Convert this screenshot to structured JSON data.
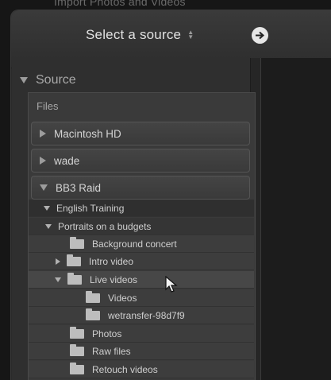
{
  "background_title": "Import Photos and Videos",
  "header": {
    "title": "Select a source",
    "updown_icon": "updown-arrows-icon",
    "next_icon": "arrow-right-circle-icon"
  },
  "source_panel": {
    "title": "Source",
    "files_label": "Files",
    "volumes": [
      {
        "label": "Macintosh HD",
        "expanded": false
      },
      {
        "label": "wade",
        "expanded": false
      },
      {
        "label": "BB3 Raid",
        "expanded": true
      }
    ],
    "folders": [
      {
        "label": "English Training",
        "level": 1,
        "expanded": true
      },
      {
        "label": "Portraits on a budgets",
        "level": 1,
        "expanded": true
      },
      {
        "label": "Background concert",
        "level": 2
      },
      {
        "label": "Intro video",
        "level": 2,
        "expanded": false
      },
      {
        "label": "Live videos",
        "level": 2,
        "expanded": true
      },
      {
        "label": "Videos",
        "level": 3
      },
      {
        "label": "wetransfer-98d7f9",
        "level": 3
      },
      {
        "label": "Photos",
        "level": 2
      },
      {
        "label": "Raw files",
        "level": 2
      },
      {
        "label": "Retouch videos",
        "level": 2
      }
    ]
  },
  "colors": {
    "dialog_bg": "#2b2b2b",
    "panel_bg": "#3a3a3a",
    "text": "#cfcfcf"
  }
}
